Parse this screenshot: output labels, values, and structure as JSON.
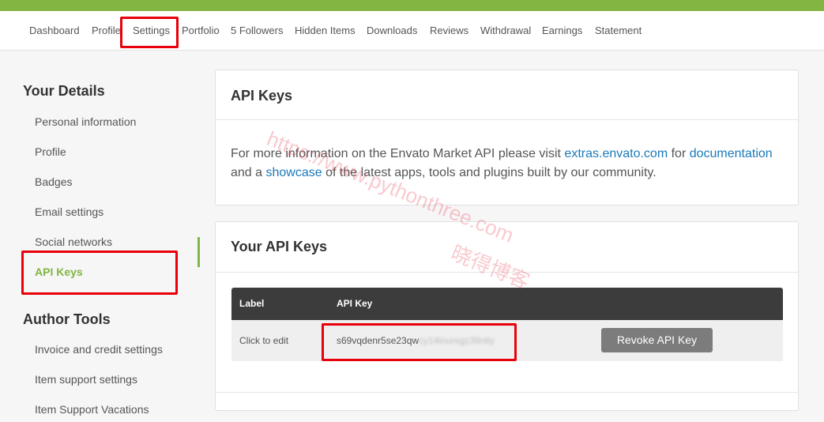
{
  "nav": {
    "items": [
      "Dashboard",
      "Profile",
      "Settings",
      "Portfolio",
      "5 Followers",
      "Hidden Items",
      "Downloads",
      "Reviews",
      "Withdrawal",
      "Earnings",
      "Statement"
    ],
    "selected": "Settings"
  },
  "sidebar": {
    "sections": [
      {
        "heading": "Your Details",
        "items": [
          "Personal information",
          "Profile",
          "Badges",
          "Email settings",
          "Social networks",
          "API Keys"
        ]
      },
      {
        "heading": "Author Tools",
        "items": [
          "Invoice and credit settings",
          "Item support settings",
          "Item Support Vacations"
        ]
      }
    ],
    "active_item": "API Keys"
  },
  "api_info": {
    "title": "API Keys",
    "text_1": "For more information on the Envato Market API please visit ",
    "link_1": "extras.envato.com",
    "text_2": " for ",
    "link_2": "documentation",
    "text_3": " and a ",
    "link_3": "showcase",
    "text_4": " of the latest apps, tools and plugins built by our community."
  },
  "your_keys": {
    "title": "Your API Keys",
    "columns": [
      "Label",
      "API Key"
    ],
    "rows": [
      {
        "label": "Click to edit",
        "key_visible": "s69vqdenr5se23qw",
        "key_blurred": "cy14inurxgz39nlly",
        "action": "Revoke API Key"
      }
    ]
  },
  "watermark": {
    "url": "https://www.pythonthree.com",
    "name": "晓得博客"
  },
  "colors": {
    "accent_green": "#82b541",
    "link_blue": "#1a7ab9",
    "highlight_red": "#e8000b",
    "table_header": "#3c3c3c",
    "button_gray": "#7c7c7c"
  }
}
